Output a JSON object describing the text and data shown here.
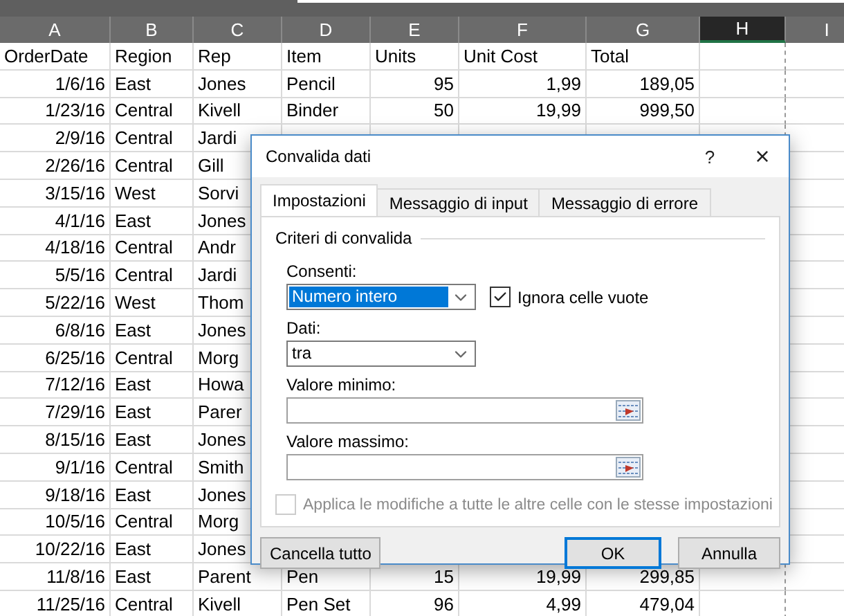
{
  "sheet": {
    "columns": [
      {
        "letter": "A",
        "selected": false
      },
      {
        "letter": "B",
        "selected": false
      },
      {
        "letter": "C",
        "selected": false
      },
      {
        "letter": "D",
        "selected": false
      },
      {
        "letter": "E",
        "selected": false
      },
      {
        "letter": "F",
        "selected": false
      },
      {
        "letter": "G",
        "selected": false
      },
      {
        "letter": "H",
        "selected": true
      },
      {
        "letter": "I",
        "selected": false
      }
    ],
    "rows": [
      {
        "kind": "header",
        "cells": [
          "OrderDate",
          "Region",
          "Rep",
          "Item",
          "Units",
          "Unit Cost",
          "Total"
        ]
      },
      {
        "kind": "data",
        "cells": [
          "1/6/16",
          "East",
          "Jones",
          "Pencil",
          "95",
          "1,99",
          "189,05"
        ]
      },
      {
        "kind": "data",
        "cells": [
          "1/23/16",
          "Central",
          "Kivell",
          "Binder",
          "50",
          "19,99",
          "999,50"
        ]
      },
      {
        "kind": "data",
        "cells": [
          "2/9/16",
          "Central",
          "Jardi"
        ]
      },
      {
        "kind": "data",
        "cells": [
          "2/26/16",
          "Central",
          "Gill"
        ]
      },
      {
        "kind": "data",
        "cells": [
          "3/15/16",
          "West",
          "Sorvi"
        ]
      },
      {
        "kind": "data",
        "cells": [
          "4/1/16",
          "East",
          "Jones"
        ]
      },
      {
        "kind": "data",
        "cells": [
          "4/18/16",
          "Central",
          "Andr"
        ]
      },
      {
        "kind": "data",
        "cells": [
          "5/5/16",
          "Central",
          "Jardi"
        ]
      },
      {
        "kind": "data",
        "cells": [
          "5/22/16",
          "West",
          "Thom"
        ]
      },
      {
        "kind": "data",
        "cells": [
          "6/8/16",
          "East",
          "Jones"
        ]
      },
      {
        "kind": "data",
        "cells": [
          "6/25/16",
          "Central",
          "Morg"
        ]
      },
      {
        "kind": "data",
        "cells": [
          "7/12/16",
          "East",
          "Howa"
        ]
      },
      {
        "kind": "data",
        "cells": [
          "7/29/16",
          "East",
          "Parer"
        ]
      },
      {
        "kind": "data",
        "cells": [
          "8/15/16",
          "East",
          "Jones"
        ]
      },
      {
        "kind": "data",
        "cells": [
          "9/1/16",
          "Central",
          "Smith"
        ]
      },
      {
        "kind": "data",
        "cells": [
          "9/18/16",
          "East",
          "Jones"
        ]
      },
      {
        "kind": "data",
        "cells": [
          "10/5/16",
          "Central",
          "Morg"
        ]
      },
      {
        "kind": "data",
        "cells": [
          "10/22/16",
          "East",
          "Jones"
        ]
      },
      {
        "kind": "data",
        "cells": [
          "11/8/16",
          "East",
          "Parent",
          "Pen",
          "15",
          "19,99",
          "299,85"
        ]
      },
      {
        "kind": "data",
        "cells": [
          "11/25/16",
          "Central",
          "Kivell",
          "Pen Set",
          "96",
          "4,99",
          "479,04"
        ]
      }
    ]
  },
  "dialog": {
    "title": "Convalida dati",
    "help": "?",
    "close": "×",
    "tabs": [
      {
        "label": "Impostazioni",
        "selected": true
      },
      {
        "label": "Messaggio di input",
        "selected": false
      },
      {
        "label": "Messaggio di errore",
        "selected": false
      }
    ],
    "group": "Criteri di convalida",
    "allow": {
      "label": "Consenti:",
      "value": "Numero intero",
      "highlighted": true
    },
    "ignore_blank": {
      "label": "Ignora celle vuote",
      "checked": true
    },
    "data": {
      "label": "Dati:",
      "value": "tra",
      "highlighted": false
    },
    "minimum": {
      "label": "Valore minimo:"
    },
    "maximum": {
      "label": "Valore massimo:"
    },
    "apply_all": {
      "label": "Applica le modifiche a tutte le altre celle con le stesse impostazioni",
      "checked": false,
      "disabled": true
    },
    "buttons": [
      {
        "label": "Cancella tutto",
        "kind": "left",
        "default": false
      },
      {
        "label": "OK",
        "kind": "right",
        "default": true
      },
      {
        "label": "Annulla",
        "kind": "right",
        "default": false
      }
    ]
  }
}
